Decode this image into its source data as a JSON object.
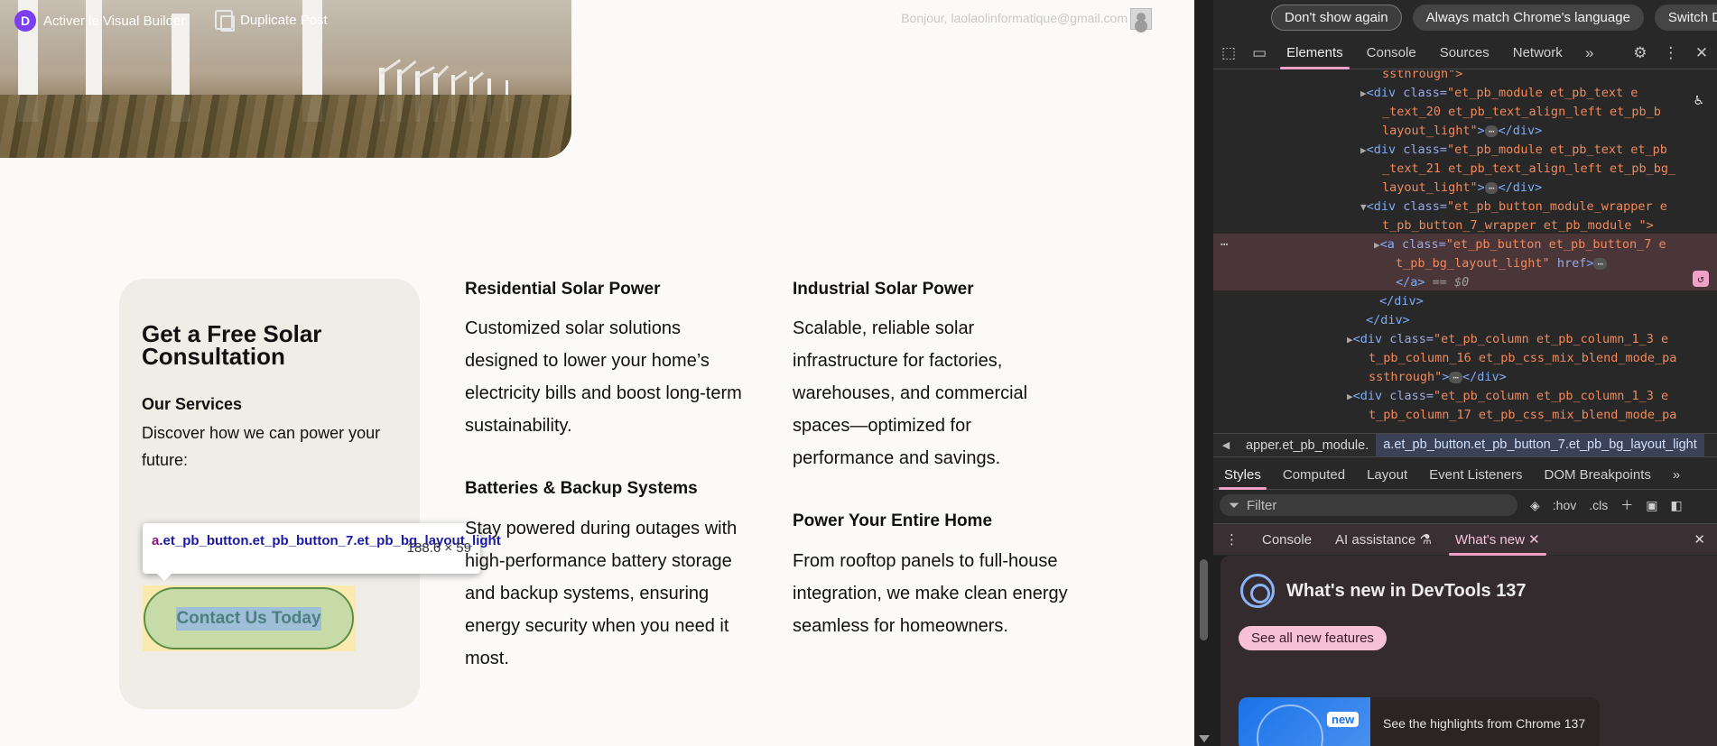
{
  "admin_bar": {
    "visual_builder": "Activer le Visual Builder",
    "duplicate_post": "Duplicate Post",
    "greeting": "Bonjour, laolaolinformatique@gmail.com"
  },
  "card": {
    "title": "Get a Free Solar Consultation",
    "subtitle": "Our Services",
    "description": "Discover how we can power your future:",
    "button": "Contact Us Today"
  },
  "tooltip": {
    "tag": "a",
    "selector": ".et_pb_button.et_pb_button_7.et_pb_bg_layout_light",
    "dimensions": "188.6 × 59"
  },
  "services": [
    {
      "title": "Residential Solar Power",
      "text": "Customized solar solutions designed to lower your home’s electricity bills and boost long-term sustainability."
    },
    {
      "title": "Industrial Solar Power",
      "text": "Scalable, reliable solar infrastructure for factories, warehouses, and commercial spaces—optimized for performance and savings."
    },
    {
      "title": "Batteries & Backup Systems",
      "text": "Stay powered during outages with high-performance battery storage and backup systems, ensuring energy security when you need it most."
    },
    {
      "title": "Power Your Entire Home",
      "text": "From rooftop panels to full-house integration, we make clean energy seamless for homeowners."
    }
  ],
  "devtools": {
    "lang_bar": [
      "Don't show again",
      "Always match Chrome's language",
      "Switch DevTools to"
    ],
    "tabs": [
      "Elements",
      "Console",
      "Sources",
      "Network"
    ],
    "breadcrumbs": [
      "apper.et_pb_module.",
      "a.et_pb_button.et_pb_button_7.et_pb_bg_layout_light"
    ],
    "style_tabs": [
      "Styles",
      "Computed",
      "Layout",
      "Event Listeners",
      "DOM Breakpoints"
    ],
    "filter_placeholder": "Filter",
    "hov": ":hov",
    "cls": ".cls",
    "drawer_tabs": [
      "Console",
      "AI assistance",
      "What's new"
    ],
    "whats_new_title": "What's new in DevTools 137",
    "whats_new_button": "See all new features",
    "whats_new_badge": "new",
    "whats_new_card": "See the highlights from Chrome 137",
    "dom": {
      "l0": "ssthrough\">",
      "l1a": "<div ",
      "l1b": "class=",
      "l1c": "\"et_pb_module et_pb_text e",
      "l2": "_text_20  et_pb_text_align_left et_pb_b",
      "l3": "layout_light\"",
      "l4c": "\"et_pb_module et_pb_text et_pb",
      "l5": "_text_21  et_pb_text_align_left et_pb_bg_",
      "l6": "layout_light\"",
      "l7c": "\"et_pb_button_module_wrapper e",
      "l8": "t_pb_button_7_wrapper  et_pb_module \">",
      "l9a": "<a ",
      "l9c": "\"et_pb_button et_pb_button_7 e",
      "l10": "t_pb_bg_layout_light\"",
      "l10b": " href",
      "l11a": "</a>",
      "l11b": " == $0",
      "l12": "</div>",
      "l13": "</div>",
      "l14c": "\"et_pb_column et_pb_column_1_3 e",
      "l15": "t_pb_column_16  et_pb_css_mix_blend_mode_pa",
      "l16": "ssthrough\"",
      "l17c": "\"et_pb_column et_pb_column_1_3 e",
      "l18": "t_pb_column_17  et_pb_css_mix_blend_mode_pa",
      "end_div": "</div>",
      "ellipsis": "⋯"
    }
  }
}
